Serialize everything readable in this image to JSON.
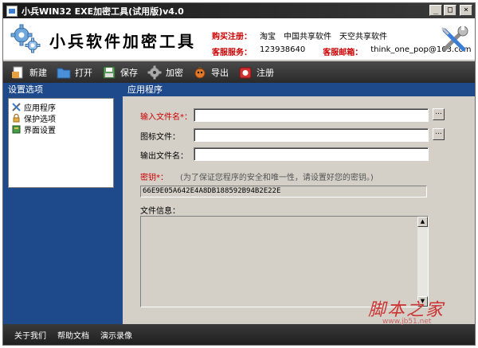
{
  "window": {
    "title": "小兵WIN32 EXE加密工具(试用版)v4.0",
    "controls": [
      "_",
      "□",
      "×"
    ]
  },
  "banner": {
    "brand": "小兵软件加密工具",
    "buy_label": "购买注册：",
    "buy_items": [
      "淘宝",
      "中国共享软件",
      "天空共享软件"
    ],
    "service_label": "客服服务：",
    "service_qq": "123938640",
    "email_label": "客服邮箱：",
    "email_value": "think_one_pop@163.com"
  },
  "toolbar": {
    "items": [
      {
        "label": "新建",
        "icon": "new-file-icon"
      },
      {
        "label": "打开",
        "icon": "open-folder-icon"
      },
      {
        "label": "保存",
        "icon": "save-icon"
      },
      {
        "label": "加密",
        "icon": "gear-icon"
      },
      {
        "label": "导出",
        "icon": "export-icon"
      },
      {
        "label": "注册",
        "icon": "register-icon"
      }
    ]
  },
  "left_panel": {
    "title": "设置选项",
    "items": [
      {
        "label": "应用程序",
        "icon": "tools-icon"
      },
      {
        "label": "保护选项",
        "icon": "lock-icon"
      },
      {
        "label": "界面设置",
        "icon": "book-icon"
      }
    ]
  },
  "right_panel": {
    "title": "应用程序",
    "input_file_label": "输入文件名*：",
    "icon_file_label": "图标文件：",
    "output_file_label": "输出文件名：",
    "browse_label": "...",
    "key_label": "密钥*：",
    "key_hint": "(为了保证您程序的安全和唯一性，请设置好您的密钥。)",
    "key_value": "66E9E05A642E4A8DB188592B94B2E22E",
    "file_info_label": "文件信息："
  },
  "footer": {
    "links": [
      "关于我们",
      "帮助文档",
      "演示录像"
    ]
  },
  "watermark": {
    "text": "脚本之家",
    "url": "www.jb51.net"
  },
  "colors": {
    "panel_blue": "#1e4a8c",
    "required_red": "#cc0000",
    "title_dark": "#1a1a1a"
  }
}
